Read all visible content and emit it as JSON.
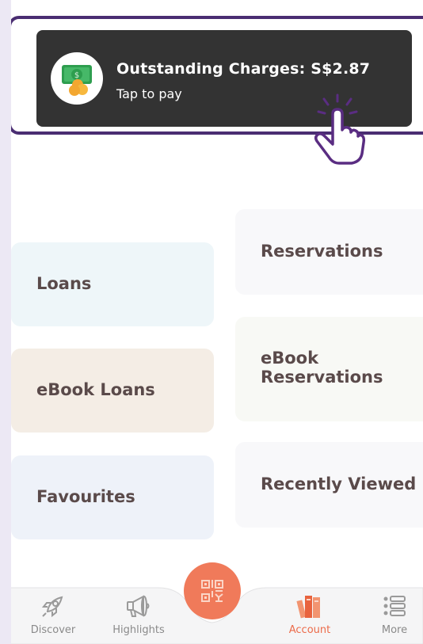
{
  "charges": {
    "title": "Outstanding Charges: S$2.87",
    "subtitle": "Tap to pay"
  },
  "tiles": {
    "loans": "Loans",
    "ebook_loans": "eBook Loans",
    "favourites": "Favourites",
    "reservations": "Reservations",
    "ebook_reservations_line1": "eBook",
    "ebook_reservations_line2": "Reservations",
    "recently_viewed": "Recently Viewed"
  },
  "nav": {
    "items": [
      {
        "label": "Discover",
        "icon": "rocket-icon"
      },
      {
        "label": "Highlights",
        "icon": "megaphone-icon"
      },
      {
        "label": "",
        "icon": "qr-code-icon"
      },
      {
        "label": "Account",
        "icon": "books-icon"
      },
      {
        "label": "More",
        "icon": "list-icon"
      }
    ]
  },
  "colors": {
    "accent": "#f07a5a",
    "highlight_border": "#4a2d72",
    "card_bg": "#333333"
  }
}
